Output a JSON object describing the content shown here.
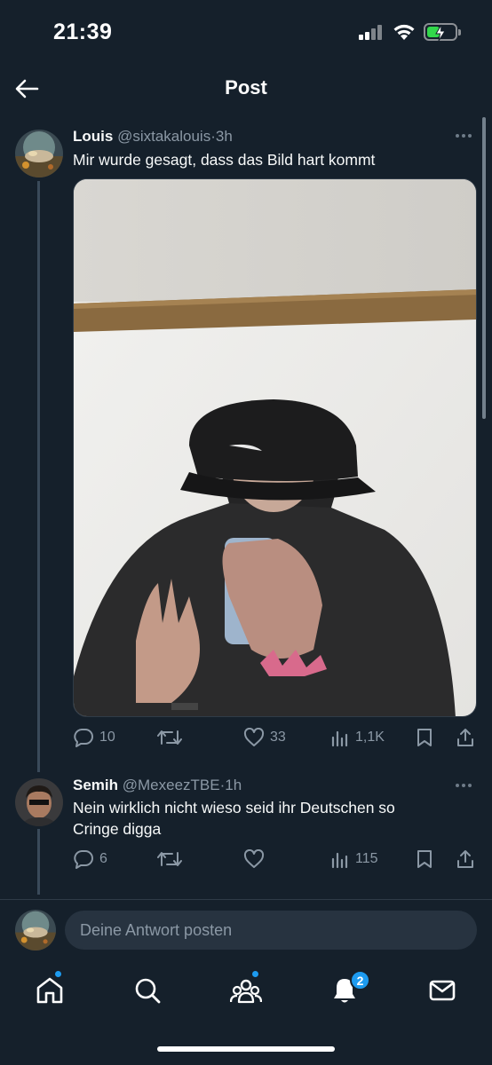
{
  "status_bar": {
    "time": "21:39"
  },
  "header": {
    "title": "Post"
  },
  "tweets": [
    {
      "name": "Louis",
      "handle": "@sixtakalouis",
      "separator": "·",
      "age": "3h",
      "text": "Mir wurde gesagt, dass das Bild hart kommt",
      "stats": {
        "replies": "10",
        "retweets": "",
        "likes": "33",
        "views": "1,1K"
      }
    },
    {
      "name": "Semih",
      "handle": "@MexeezTBE",
      "separator": "·",
      "age": "1h",
      "text": "Nein wirklich nicht wieso seid ihr Deutschen so Cringe digga",
      "stats": {
        "replies": "6",
        "retweets": "",
        "likes": "",
        "views": "115"
      }
    }
  ],
  "reply": {
    "placeholder": "Deine Antwort posten"
  },
  "tabbar": {
    "tabs": [
      "home-icon",
      "search-icon",
      "communities-icon",
      "notifications-icon",
      "messages-icon"
    ],
    "notification_count": "2"
  },
  "colors": {
    "background": "#15202b",
    "accent": "#1d9bf0",
    "muted": "#8b98a5"
  }
}
